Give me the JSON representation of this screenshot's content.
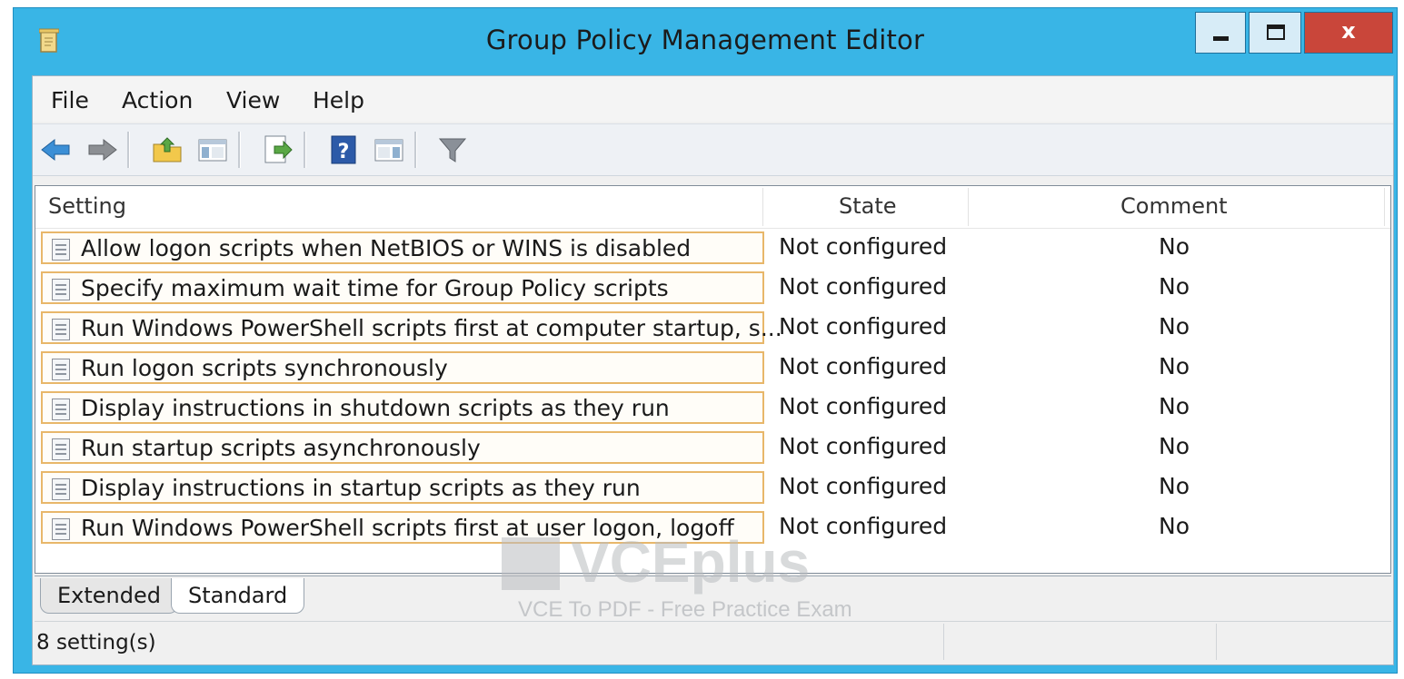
{
  "window": {
    "title": "Group Policy Management Editor",
    "close_glyph": "x"
  },
  "menu": [
    "File",
    "Action",
    "View",
    "Help"
  ],
  "toolbar": {
    "icons": [
      "back-arrow-icon",
      "forward-arrow-icon",
      "up-folder-icon",
      "show-hide-console-tree-icon",
      "export-list-icon",
      "help-icon",
      "show-action-pane-icon",
      "filter-icon"
    ]
  },
  "list": {
    "columns": [
      "Setting",
      "State",
      "Comment"
    ],
    "rows": [
      {
        "setting": "Allow logon scripts when NetBIOS or WINS is disabled",
        "state": "Not configured",
        "comment": "No"
      },
      {
        "setting": "Specify maximum wait time for Group Policy scripts",
        "state": "Not configured",
        "comment": "No"
      },
      {
        "setting": "Run Windows PowerShell scripts first at computer startup, s...",
        "state": "Not configured",
        "comment": "No"
      },
      {
        "setting": "Run logon scripts synchronously",
        "state": "Not configured",
        "comment": "No"
      },
      {
        "setting": "Display instructions in shutdown scripts as they run",
        "state": "Not configured",
        "comment": "No"
      },
      {
        "setting": "Run startup scripts asynchronously",
        "state": "Not configured",
        "comment": "No"
      },
      {
        "setting": "Display instructions in startup scripts as they run",
        "state": "Not configured",
        "comment": "No"
      },
      {
        "setting": "Run Windows PowerShell scripts first at user logon, logoff",
        "state": "Not configured",
        "comment": "No"
      }
    ]
  },
  "tabs": [
    "Extended",
    "Standard"
  ],
  "status": "8 setting(s)",
  "watermark": {
    "main": "VCEplus",
    "sub": "VCE To PDF - Free Practice Exam"
  },
  "colors": {
    "title_bar": "#39b5e6",
    "close_button": "#c9463a",
    "row_highlight_border": "#e8b76a"
  }
}
